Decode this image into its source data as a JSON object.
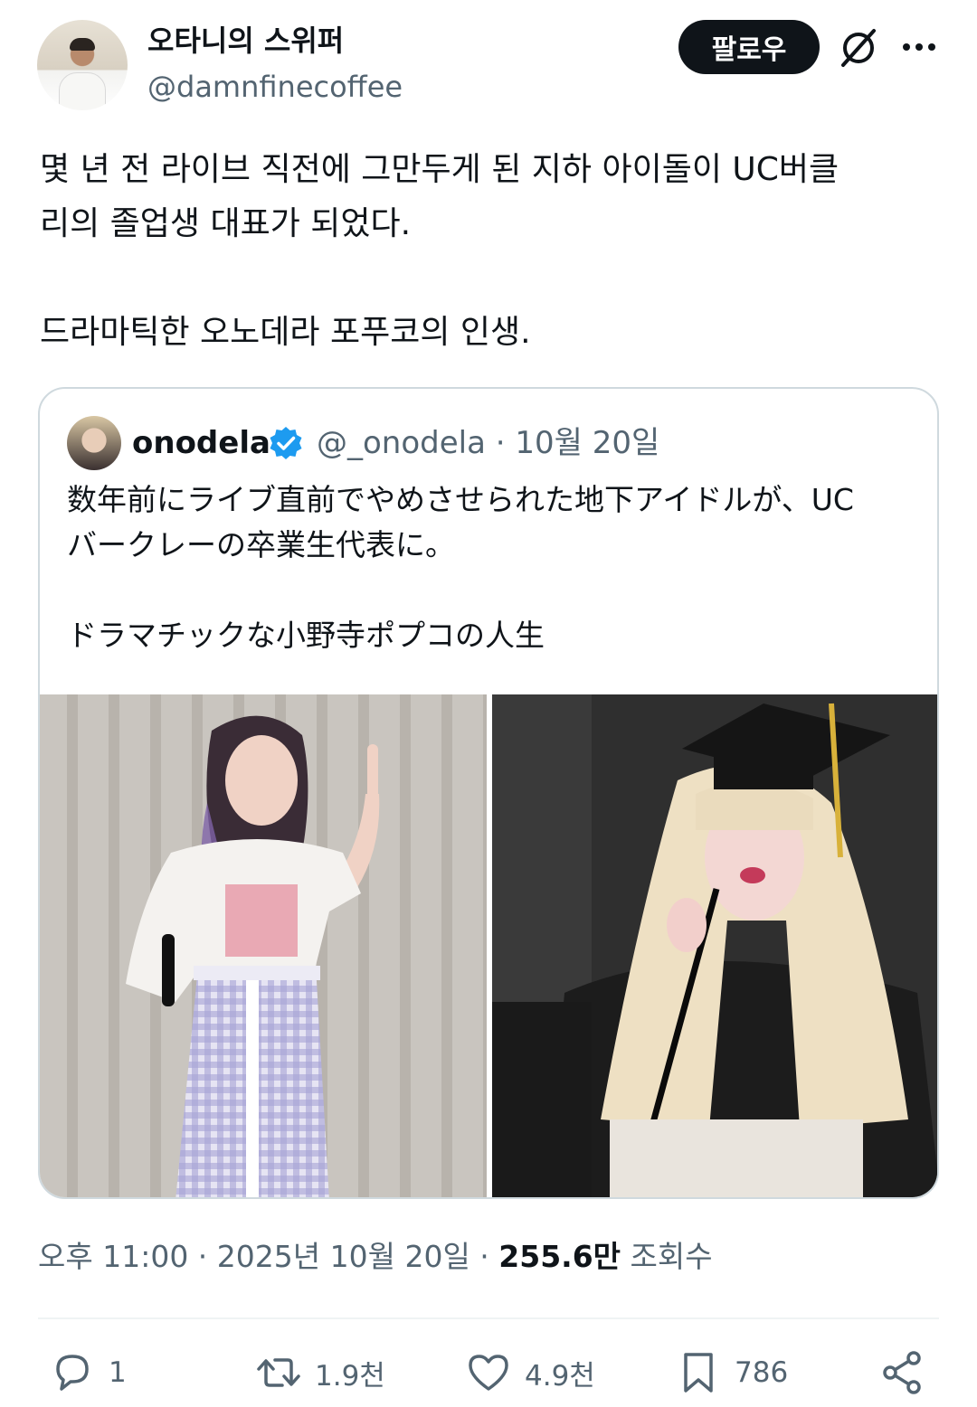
{
  "author": {
    "display_name": "오타니의 스위퍼",
    "handle": "@damnfinecoffee",
    "follow_label": "팔로우"
  },
  "tweet": {
    "text": "몇 년 전 라이브 직전에 그만두게 된 지하 아이돌이 UC버클\n리의 졸업생 대표가 되었다.\n\n드라마틱한 오노데라 포푸코의 인생."
  },
  "quote": {
    "name": "onodela",
    "handle_date": "@_onodela · 10월 20일",
    "text": "数年前にライブ直前でやめさせられた地下アイドルが、UC\nバークレーの卒業生代表に。\n\nドラマチックな小野寺ポプコの人生"
  },
  "meta": {
    "time_date": "오후 11:00 · 2025년 10월 20일 · ",
    "views_count": "255.6만",
    "views_label": " 조회수"
  },
  "actions": {
    "reply_count": "1",
    "repost_count": "1.9천",
    "like_count": "4.9천",
    "bookmark_count": "786"
  },
  "icons": [
    "grok-icon",
    "more-icon",
    "verified-badge-icon",
    "reply-icon",
    "repost-icon",
    "like-icon",
    "bookmark-icon",
    "share-icon"
  ],
  "colors": {
    "text_primary": "#0f1419",
    "text_secondary": "#536471",
    "verified_blue": "#1d9bf0",
    "border": "#cfd9de"
  }
}
